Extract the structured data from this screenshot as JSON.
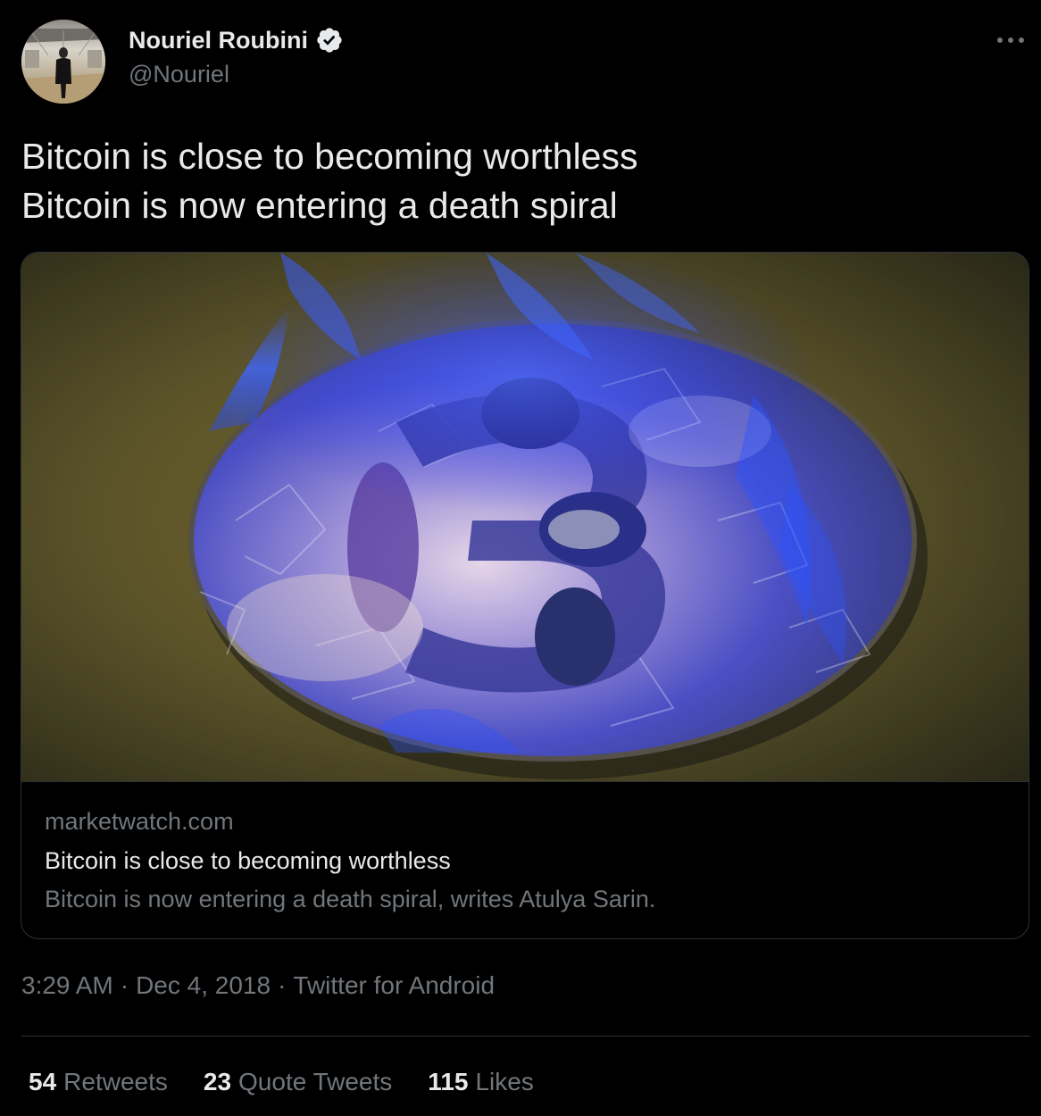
{
  "author": {
    "display_name": "Nouriel Roubini",
    "handle": "@Nouriel",
    "verified": true,
    "avatar_icon": "avatar-person-in-gallery"
  },
  "tweet": {
    "lines": [
      "Bitcoin is close to becoming worthless",
      "Bitcoin is now entering a death spiral"
    ]
  },
  "card": {
    "image_icon": "burning-bitcoin-foil-image",
    "domain": "marketwatch.com",
    "title": "Bitcoin is close to becoming worthless",
    "description": "Bitcoin is now entering a death spiral, writes Atulya Sarin."
  },
  "meta": {
    "time": "3:29 AM",
    "separator": "·",
    "date": "Dec 4, 2018",
    "source": "Twitter for Android"
  },
  "stats": [
    {
      "count": "54",
      "label": "Retweets"
    },
    {
      "count": "23",
      "label": "Quote Tweets"
    },
    {
      "count": "115",
      "label": "Likes"
    }
  ],
  "colors": {
    "background": "#000000",
    "primary_text": "#e7e9ea",
    "secondary_text": "#71767b",
    "border": "#2f3336",
    "verified_badge": "#e7e9ea"
  }
}
